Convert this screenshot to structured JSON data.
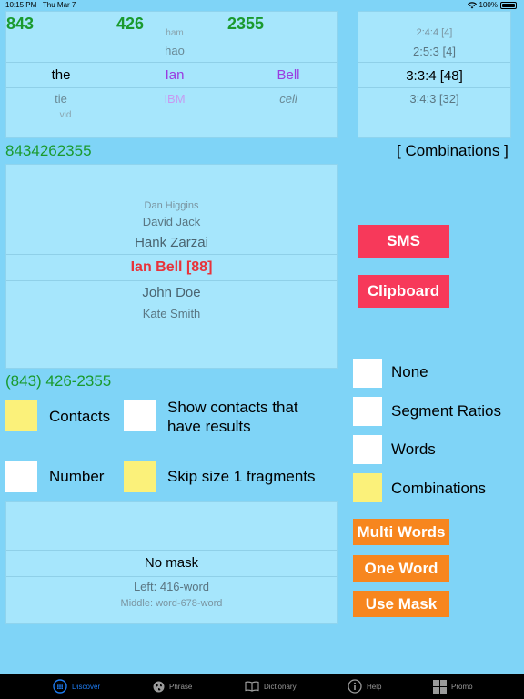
{
  "status_bar": {
    "time": "10:15 PM",
    "date": "Thu Mar 7",
    "battery": "100%"
  },
  "digit_groups": [
    "843",
    "426",
    "2355"
  ],
  "picker_words": {
    "col1": [
      "the",
      "tie",
      "vid"
    ],
    "col2": [
      "ham",
      "hao",
      "Ian",
      "IBM"
    ],
    "col3": [
      "Bell",
      "cell"
    ]
  },
  "ratio_picker": [
    "2:4:4  [4]",
    "2:5:3  [4]",
    "3:3:4  [48]",
    "3:4:3  [32]"
  ],
  "phone_digits": "8434262355",
  "combinations_label": "[ Combinations ]",
  "contacts_picker": [
    "Dan Higgins",
    "David Jack",
    "Hank Zarzai",
    "Ian Bell  [88]",
    "John Doe",
    "Kate Smith"
  ],
  "buttons": {
    "sms": "SMS",
    "clipboard": "Clipboard",
    "multi_words": "Multi Words",
    "one_word": "One Word",
    "use_mask": "Use Mask"
  },
  "formatted_phone": "(843) 426-2355",
  "options": {
    "contacts": "Contacts",
    "show_contacts_line1": "Show contacts that",
    "show_contacts_line2": "have results",
    "number": "Number",
    "skip_size": "Skip size 1 fragments"
  },
  "modes": {
    "none": "None",
    "segment_ratios": "Segment Ratios",
    "words": "Words",
    "combinations": "Combinations"
  },
  "mask_picker": [
    "No mask",
    "Left: 416-word",
    "Middle: word-678-word"
  ],
  "tabs": [
    "Discover",
    "Phrase",
    "Dictionary",
    "Help",
    "Promo"
  ],
  "colors": {
    "green": "#1a9a2e",
    "purple": "#9a3be0",
    "red": "#e8333a",
    "accent": "#1e7cf2"
  }
}
